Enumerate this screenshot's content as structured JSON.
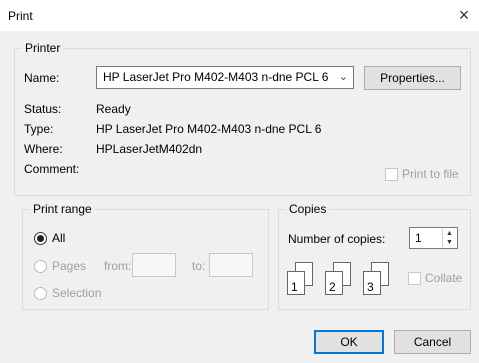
{
  "window": {
    "title": "Print",
    "close_glyph": "×"
  },
  "printer": {
    "group_label": "Printer",
    "name_label": "Name:",
    "name_value": "HP LaserJet Pro M402-M403 n-dne PCL 6",
    "properties_label": "Properties...",
    "status_label": "Status:",
    "status_value": "Ready",
    "type_label": "Type:",
    "type_value": "HP LaserJet Pro M402-M403 n-dne PCL 6",
    "where_label": "Where:",
    "where_value": "HPLaserJetM402dn",
    "comment_label": "Comment:",
    "print_to_file_label": "Print to file",
    "print_to_file_checked": false
  },
  "print_range": {
    "group_label": "Print range",
    "all_label": "All",
    "pages_label": "Pages",
    "from_label": "from:",
    "to_label": "to:",
    "from_value": "",
    "to_value": "",
    "selection_label": "Selection",
    "selected": "All"
  },
  "copies": {
    "group_label": "Copies",
    "number_label": "Number of copies:",
    "number_value": "1",
    "collate_label": "Collate",
    "collate_checked": false,
    "collate_page_numbers": [
      "1",
      "1",
      "2",
      "2",
      "3",
      "3"
    ]
  },
  "footer": {
    "ok_label": "OK",
    "cancel_label": "Cancel"
  },
  "icons": {
    "close": "close-icon",
    "dropdown": "chevron-down-icon",
    "spin_up": "spin-up-icon",
    "spin_down": "spin-down-icon",
    "collate_pages": "collate-pages-icon"
  }
}
